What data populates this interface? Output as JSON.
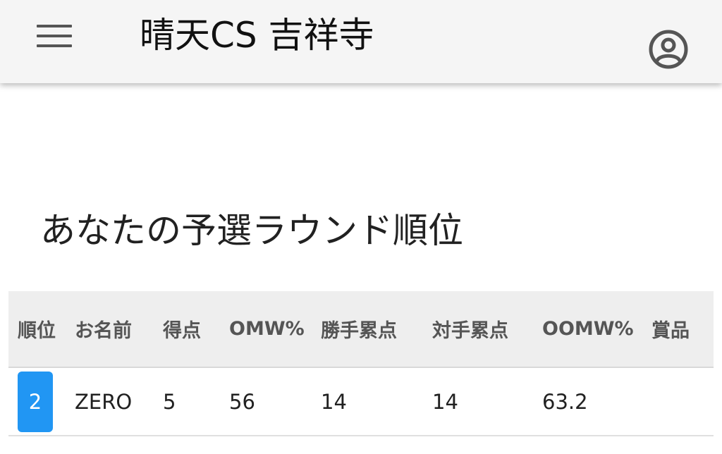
{
  "header": {
    "title": "晴天CS 吉祥寺",
    "menu_icon": "hamburger-menu-icon",
    "account_icon": "account-circle-icon"
  },
  "main": {
    "section_title": "あなたの予選ラウンド順位"
  },
  "table": {
    "columns": [
      "順位",
      "お名前",
      "得点",
      "OMW%",
      "勝手累点",
      "対手累点",
      "OOMW%",
      "賞品"
    ],
    "rows": [
      [
        "2",
        "ZERO",
        "5",
        "56",
        "14",
        "14",
        "63.2",
        ""
      ]
    ]
  },
  "colors": {
    "app_bar": "#f5f5f5",
    "header_row": "#eeeeee",
    "rank_badge": "#2196f3"
  }
}
